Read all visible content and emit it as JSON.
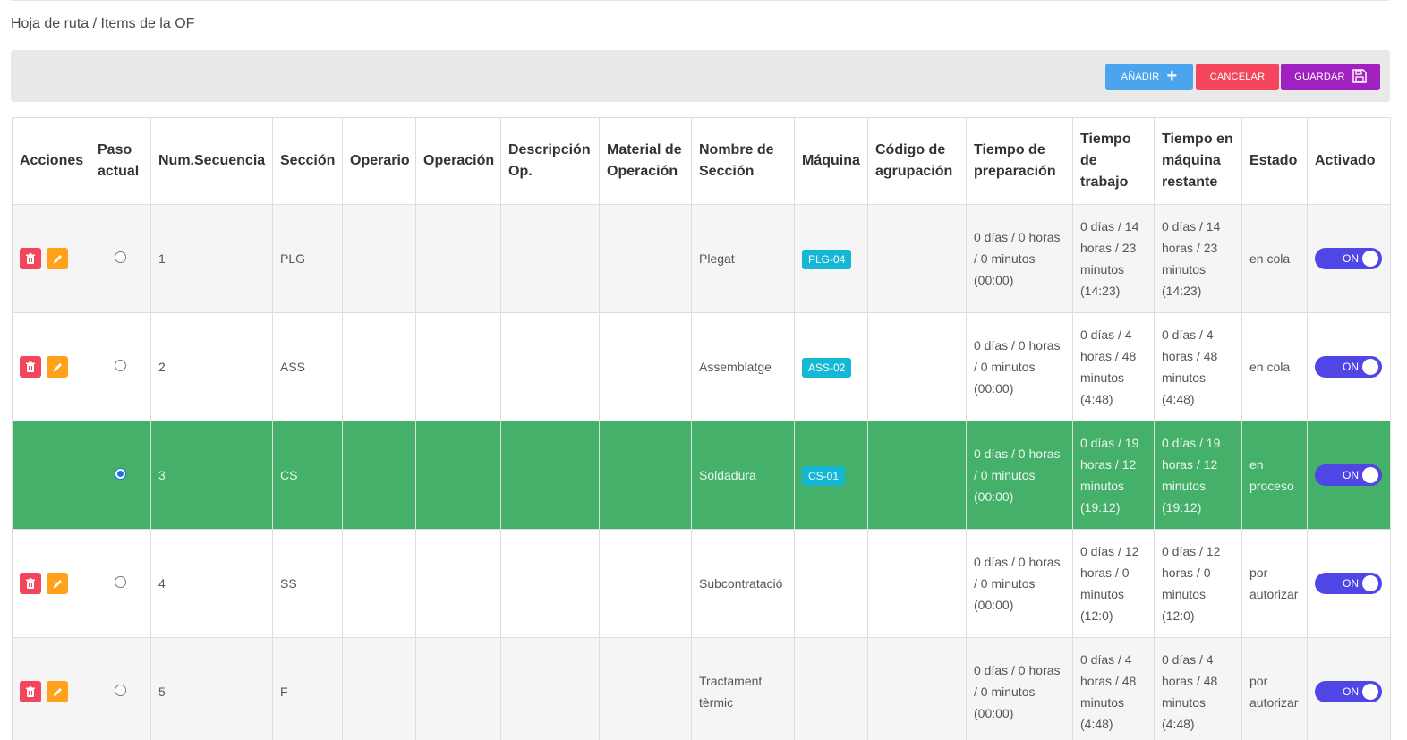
{
  "breadcrumb": "Hoja de ruta / Items de la OF",
  "toolbar": {
    "add_label": "AÑADIR",
    "cancel_label": "CANCELAR",
    "save_label": "GUARDAR"
  },
  "colors": {
    "add": "#4aa4ee",
    "cancel": "#f4455c",
    "save": "#a020c0",
    "active_row": "#44b06a",
    "badge": "#15b8d4",
    "toggle": "#4f46e5",
    "delete_icon_bg": "#f4455c",
    "edit_icon_bg": "#ffa21a"
  },
  "icons": {
    "add": "plus-icon",
    "save": "floppy-disk-icon",
    "delete": "trash-icon",
    "edit": "pencil-icon"
  },
  "columns": [
    "Acciones",
    "Paso actual",
    "Num.Secuencia",
    "Sección",
    "Operario",
    "Operación",
    "Descripción Op.",
    "Material de Operación",
    "Nombre de Sección",
    "Máquina",
    "Código de agrupación",
    "Tiempo de preparación",
    "Tiempo de trabajo",
    "Tiempo en máquina restante",
    "Estado",
    "Activado"
  ],
  "rows": [
    {
      "actions": true,
      "current": false,
      "seq": "1",
      "section": "PLG",
      "operator": "",
      "operation": "",
      "desc": "",
      "material": "",
      "section_name": "Plegat",
      "machine": "PLG-04",
      "group_code": "",
      "prep": "0 días / 0 horas / 0 minutos (00:00)",
      "work": "0 días / 14 horas / 23 minutos (14:23)",
      "remaining": "0 días / 14 horas / 23 minutos (14:23)",
      "status": "en cola",
      "enabled": "ON"
    },
    {
      "actions": true,
      "current": false,
      "seq": "2",
      "section": "ASS",
      "operator": "",
      "operation": "",
      "desc": "",
      "material": "",
      "section_name": "Assemblatge",
      "machine": "ASS-02",
      "group_code": "",
      "prep": "0 días / 0 horas / 0 minutos (00:00)",
      "work": "0 días / 4 horas / 48 minutos (4:48)",
      "remaining": "0 días / 4 horas / 48 minutos (4:48)",
      "status": "en cola",
      "enabled": "ON"
    },
    {
      "actions": false,
      "current": true,
      "seq": "3",
      "section": "CS",
      "operator": "",
      "operation": "",
      "desc": "",
      "material": "",
      "section_name": "Soldadura",
      "machine": "CS-01",
      "group_code": "",
      "prep": "0 días / 0 horas / 0 minutos (00:00)",
      "work": "0 días / 19 horas / 12 minutos (19:12)",
      "remaining": "0 días / 19 horas / 12 minutos (19:12)",
      "status": "en proceso",
      "enabled": "ON"
    },
    {
      "actions": true,
      "current": false,
      "seq": "4",
      "section": "SS",
      "operator": "",
      "operation": "",
      "desc": "",
      "material": "",
      "section_name": "Subcontratació",
      "machine": "",
      "group_code": "",
      "prep": "0 días / 0 horas / 0 minutos (00:00)",
      "work": "0 días / 12 horas / 0 minutos (12:0)",
      "remaining": "0 días / 12 horas / 0 minutos (12:0)",
      "status": "por autorizar",
      "enabled": "ON"
    },
    {
      "actions": true,
      "current": false,
      "seq": "5",
      "section": "F",
      "operator": "",
      "operation": "",
      "desc": "",
      "material": "",
      "section_name": "Tractament tèrmic",
      "machine": "",
      "group_code": "",
      "prep": "0 días / 0 horas / 0 minutos (00:00)",
      "work": "0 días / 4 horas / 48 minutos (4:48)",
      "remaining": "0 días / 4 horas / 48 minutos (4:48)",
      "status": "por autorizar",
      "enabled": "ON"
    }
  ]
}
